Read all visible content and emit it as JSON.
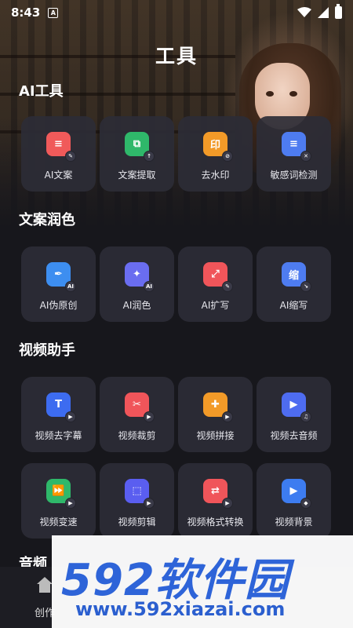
{
  "status_bar": {
    "time": "8:43",
    "notif": "A"
  },
  "page_title": "工具",
  "sections": [
    {
      "title": "AI工具",
      "items": [
        {
          "label": "AI文案",
          "icon": "doc-edit-icon",
          "glyph": "≡",
          "color": "#f05a5a",
          "badge": "✎"
        },
        {
          "label": "文案提取",
          "icon": "doc-extract-icon",
          "glyph": "⧉",
          "color": "#2fb86a",
          "badge": "↑"
        },
        {
          "label": "去水印",
          "icon": "stamp-icon",
          "glyph": "印",
          "color": "#f29a28",
          "badge": "⊘"
        },
        {
          "label": "敏感词检测",
          "icon": "doc-check-icon",
          "glyph": "≡",
          "color": "#4e7cf0",
          "badge": "✕"
        }
      ]
    },
    {
      "title": "文案润色",
      "items": [
        {
          "label": "AI伪原创",
          "icon": "pen-ai-icon",
          "glyph": "✒",
          "color": "#3d8ef0",
          "badge": "AI"
        },
        {
          "label": "AI润色",
          "icon": "wand-ai-icon",
          "glyph": "✦",
          "color": "#6a6df0",
          "badge": "AI"
        },
        {
          "label": "AI扩写",
          "icon": "image-expand-icon",
          "glyph": "⤢",
          "color": "#f0555a",
          "badge": "✎"
        },
        {
          "label": "AI缩写",
          "icon": "shrink-icon",
          "glyph": "缩",
          "color": "#4e7cf0",
          "badge": "↘"
        }
      ]
    },
    {
      "title": "视频助手",
      "items": [
        {
          "label": "视频去字幕",
          "icon": "subtitle-remove-icon",
          "glyph": "T",
          "color": "#3d6cf0",
          "badge": "▶"
        },
        {
          "label": "视频裁剪",
          "icon": "scissors-icon",
          "glyph": "✂",
          "color": "#f0555a",
          "badge": "▶"
        },
        {
          "label": "视频拼接",
          "icon": "puzzle-icon",
          "glyph": "✚",
          "color": "#f29a28",
          "badge": "▶"
        },
        {
          "label": "视频去音频",
          "icon": "video-mute-icon",
          "glyph": "▶",
          "color": "#4e6cf0",
          "badge": "♫"
        }
      ]
    },
    {
      "title": "",
      "items": [
        {
          "label": "视频变速",
          "icon": "speed-icon",
          "glyph": "⏩",
          "color": "#2fb86a",
          "badge": "▶"
        },
        {
          "label": "视频剪辑",
          "icon": "crop-icon",
          "glyph": "⬚",
          "color": "#5a5ef0",
          "badge": "▶"
        },
        {
          "label": "视频格式转换",
          "icon": "convert-icon",
          "glyph": "⇄",
          "color": "#f0555a",
          "badge": "▶"
        },
        {
          "label": "视频背景",
          "icon": "video-bg-icon",
          "glyph": "▶",
          "color": "#3d7cf0",
          "badge": "◆"
        }
      ]
    }
  ],
  "next_section_partial": "音频",
  "bottom_nav": {
    "item": "创作"
  },
  "watermark": {
    "logo": "592软件园",
    "url": "www.592xiazai.com"
  }
}
